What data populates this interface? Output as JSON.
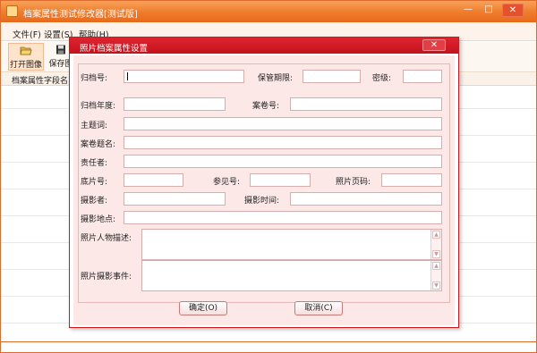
{
  "main_window": {
    "title": "档案属性测试修改器[测试版]",
    "controls": {
      "minimize": "—",
      "maximize": "□",
      "close": "✕"
    }
  },
  "menu": {
    "file": "文件(F)",
    "settings": "设置(S)",
    "help": "帮助(H)"
  },
  "toolbar": {
    "open_image": "打开图像",
    "save_image": "保存图"
  },
  "field_table": {
    "column_label": "档案属性字段名"
  },
  "dialog": {
    "title": "照片档案属性设置",
    "close": "✕",
    "labels": {
      "archive_no": "归档号:",
      "retention": "保管期限:",
      "secret_level": "密级:",
      "archive_year": "归档年度:",
      "case_no": "案卷号:",
      "subject": "主题词:",
      "case_title": "案卷题名:",
      "responsible": "责任者:",
      "negative_no": "底片号:",
      "ref_no": "参见号:",
      "photo_page": "照片页码:",
      "photographer": "摄影者:",
      "photo_time": "摄影时间:",
      "photo_place": "摄影地点:",
      "people_desc": "照片人物描述:",
      "photo_event": "照片摄影事件:"
    },
    "values": {
      "archive_no": "",
      "retention": "",
      "secret_level": "",
      "archive_year": "",
      "case_no": "",
      "subject": "",
      "case_title": "",
      "responsible": "",
      "negative_no": "",
      "ref_no": "",
      "photo_page": "",
      "photographer": "",
      "photo_time": "",
      "photo_place": "",
      "people_desc": "",
      "photo_event": ""
    },
    "buttons": {
      "ok": "确定(O)",
      "cancel": "取消(C)"
    }
  },
  "colors": {
    "main_title_accent": "#ef7b2b",
    "dialog_title_accent": "#c3131c",
    "dialog_body": "#fde8e8"
  }
}
